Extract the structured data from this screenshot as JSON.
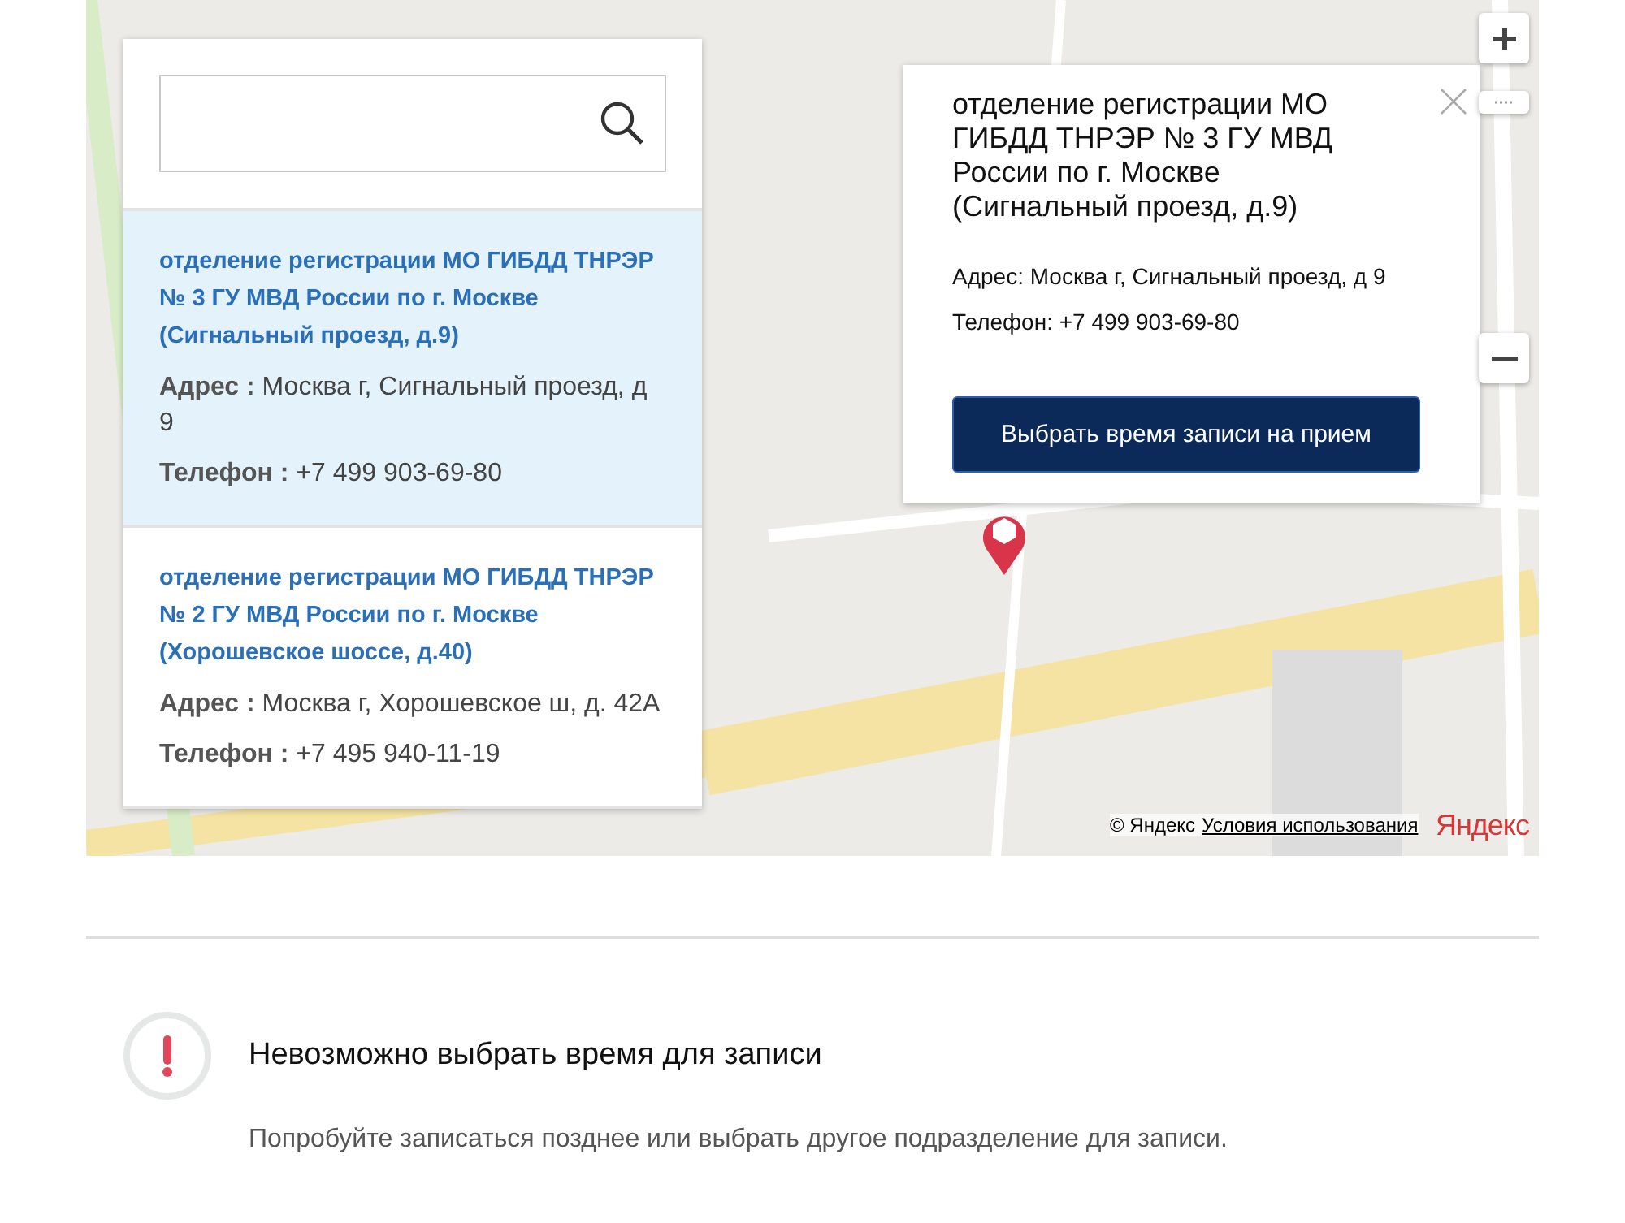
{
  "results": [
    {
      "title": "отделение регистрации МО ГИБДД ТНРЭР № 3 ГУ МВД России по г. Москве (Сигнальный проезд, д.9)",
      "address_label": "Адрес :",
      "address": "Москва г, Сигнальный проезд, д 9",
      "phone_label": "Телефон :",
      "phone": "+7 499 903-69-80",
      "selected": true
    },
    {
      "title": "отделение регистрации МО ГИБДД ТНРЭР № 2 ГУ МВД России по г. Москве (Хорошевское шоссе, д.40)",
      "address_label": "Адрес :",
      "address": "Москва г, Хорошевское ш, д. 42А",
      "phone_label": "Телефон :",
      "phone": "+7 495 940-11-19",
      "selected": false
    }
  ],
  "popup": {
    "title": "отделение регистрации МО ГИБДД ТНРЭР № 3 ГУ МВД России по г. Москве (Сигнальный проезд, д.9)",
    "address": "Адрес: Москва г, Сигнальный проезд, д 9",
    "phone": "Телефон: +7 499 903-69-80",
    "button": "Выбрать время записи на прием"
  },
  "map": {
    "attribution": "© Яндекс",
    "terms_link": "Условия использования",
    "logo": "Яндекс"
  },
  "notice": {
    "title": "Невозможно выбрать время для записи",
    "message": "Попробуйте записаться позднее или выбрать другое подразделение для записи."
  }
}
